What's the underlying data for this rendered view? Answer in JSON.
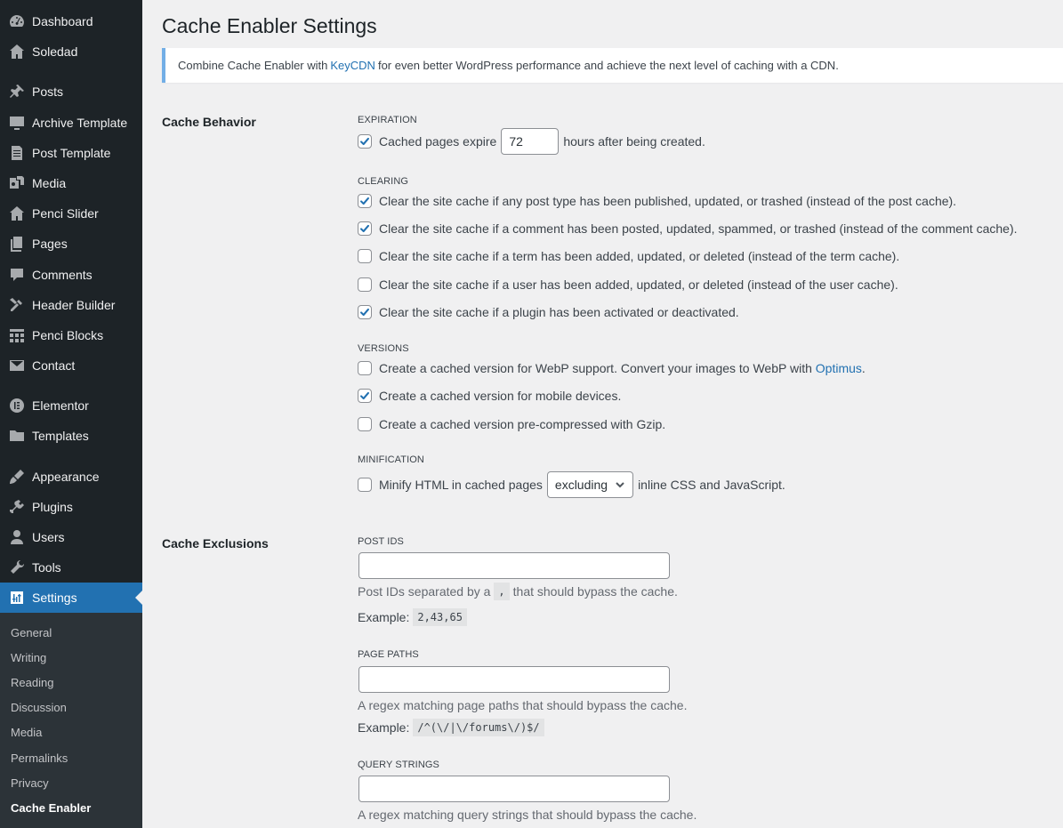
{
  "sidebar": {
    "items": [
      {
        "label": "Dashboard",
        "icon": "dashboard-icon"
      },
      {
        "label": "Soledad",
        "icon": "home-icon"
      },
      {
        "label": "Posts",
        "icon": "pin-icon"
      },
      {
        "label": "Archive Template",
        "icon": "monitor-icon"
      },
      {
        "label": "Post Template",
        "icon": "document-icon"
      },
      {
        "label": "Media",
        "icon": "media-icon"
      },
      {
        "label": "Penci Slider",
        "icon": "home-icon"
      },
      {
        "label": "Pages",
        "icon": "pages-icon"
      },
      {
        "label": "Comments",
        "icon": "comment-icon"
      },
      {
        "label": "Header Builder",
        "icon": "tools-icon"
      },
      {
        "label": "Penci Blocks",
        "icon": "grid-icon"
      },
      {
        "label": "Contact",
        "icon": "mail-icon"
      },
      {
        "label": "Elementor",
        "icon": "elementor-icon"
      },
      {
        "label": "Templates",
        "icon": "folder-icon"
      },
      {
        "label": "Appearance",
        "icon": "brush-icon"
      },
      {
        "label": "Plugins",
        "icon": "plug-icon"
      },
      {
        "label": "Users",
        "icon": "user-icon"
      },
      {
        "label": "Tools",
        "icon": "wrench-icon"
      },
      {
        "label": "Settings",
        "icon": "settings-icon",
        "active": true
      }
    ],
    "submenu": [
      "General",
      "Writing",
      "Reading",
      "Discussion",
      "Media",
      "Permalinks",
      "Privacy",
      "Cache Enabler"
    ],
    "current_submenu": "Cache Enabler",
    "accent_color": "#2271b1"
  },
  "page": {
    "title": "Cache Enabler Settings",
    "notice": {
      "before": "Combine Cache Enabler with ",
      "link": "KeyCDN",
      "after": " for even better WordPress performance and achieve the next level of caching with a CDN."
    }
  },
  "cache_behavior": {
    "heading": "Cache Behavior",
    "expiration": {
      "label": "Expiration",
      "checked": true,
      "before": "Cached pages expire",
      "value": "72",
      "after": "hours after being created."
    },
    "clearing": {
      "label": "Clearing",
      "options": [
        {
          "text": "Clear the site cache if any post type has been published, updated, or trashed (instead of the post cache).",
          "checked": true
        },
        {
          "text": "Clear the site cache if a comment has been posted, updated, spammed, or trashed (instead of the comment cache).",
          "checked": true
        },
        {
          "text": "Clear the site cache if a term has been added, updated, or deleted (instead of the term cache).",
          "checked": false
        },
        {
          "text": "Clear the site cache if a user has been added, updated, or deleted (instead of the user cache).",
          "checked": false
        },
        {
          "text": "Clear the site cache if a plugin has been activated or deactivated.",
          "checked": true
        }
      ]
    },
    "versions": {
      "label": "Versions",
      "webp": {
        "before": "Create a cached version for WebP support. Convert your images to WebP with ",
        "link": "Optimus",
        "after": ".",
        "checked": false
      },
      "mobile": {
        "text": "Create a cached version for mobile devices.",
        "checked": true
      },
      "gzip": {
        "text": "Create a cached version pre-compressed with Gzip.",
        "checked": false
      }
    },
    "minification": {
      "label": "Minification",
      "checked": false,
      "before": "Minify HTML in cached pages",
      "select_value": "excluding",
      "after": "inline CSS and JavaScript."
    }
  },
  "cache_exclusions": {
    "heading": "Cache Exclusions",
    "post_ids": {
      "label": "Post IDs",
      "value": "",
      "desc_before": "Post IDs separated by a",
      "desc_code": ",",
      "desc_after": "that should bypass the cache.",
      "example_label": "Example:",
      "example": "2,43,65"
    },
    "page_paths": {
      "label": "Page Paths",
      "value": "",
      "desc": "A regex matching page paths that should bypass the cache.",
      "example_label": "Example:",
      "example": "/^(\\/|\\/forums\\/)$/"
    },
    "query_strings": {
      "label": "Query Strings",
      "value": "",
      "desc": "A regex matching query strings that should bypass the cache."
    }
  }
}
